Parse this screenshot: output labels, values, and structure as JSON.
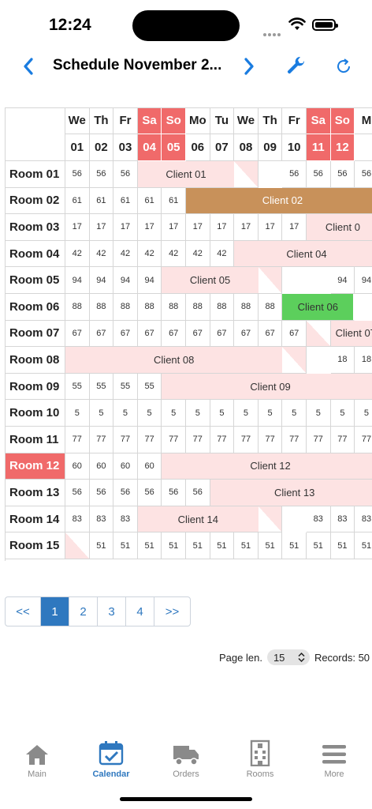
{
  "status": {
    "time": "12:24"
  },
  "nav": {
    "title": "Schedule November 2..."
  },
  "colors": {
    "accent": "#2f78bf",
    "weekend": "#f06a6a",
    "booking_pink": "#fde3e3",
    "booking_brown": "#c8915a",
    "booking_green": "#5ccf5c"
  },
  "days": [
    {
      "dow": "We",
      "date": "01",
      "we": false
    },
    {
      "dow": "Th",
      "date": "02",
      "we": false
    },
    {
      "dow": "Fr",
      "date": "03",
      "we": false
    },
    {
      "dow": "Sa",
      "date": "04",
      "we": true
    },
    {
      "dow": "So",
      "date": "05",
      "we": true
    },
    {
      "dow": "Mo",
      "date": "06",
      "we": false
    },
    {
      "dow": "Tu",
      "date": "07",
      "we": false
    },
    {
      "dow": "We",
      "date": "08",
      "we": false
    },
    {
      "dow": "Th",
      "date": "09",
      "we": false
    },
    {
      "dow": "Fr",
      "date": "10",
      "we": false
    },
    {
      "dow": "Sa",
      "date": "11",
      "we": true
    },
    {
      "dow": "So",
      "date": "12",
      "we": true
    },
    {
      "dow": "M",
      "date": "",
      "we": false
    }
  ],
  "rooms": [
    {
      "name": "Room 01",
      "price": "56",
      "selected": false,
      "free": [
        0,
        1,
        2,
        9,
        10,
        11,
        12
      ],
      "booking": {
        "label": "Client 01",
        "start": 3,
        "end": 7,
        "color": "pink",
        "tail": true,
        "head": false
      }
    },
    {
      "name": "Room 02",
      "price": "61",
      "selected": false,
      "free": [
        0,
        1,
        2,
        3,
        4
      ],
      "booking": {
        "label": "Client 02",
        "start": 5,
        "end": 12,
        "color": "brown",
        "tail": false,
        "head": false
      }
    },
    {
      "name": "Room 03",
      "price": "17",
      "selected": false,
      "free": [
        0,
        1,
        2,
        3,
        4,
        5,
        6,
        7,
        8,
        9
      ],
      "booking": {
        "label": "Client 0",
        "start": 10,
        "end": 12,
        "color": "pink",
        "tail": false,
        "head": false
      }
    },
    {
      "name": "Room 04",
      "price": "42",
      "selected": false,
      "free": [
        0,
        1,
        2,
        3,
        4,
        5,
        6
      ],
      "booking": {
        "label": "Client 04",
        "start": 7,
        "end": 12,
        "color": "pink",
        "tail": false,
        "head": false
      }
    },
    {
      "name": "Room 05",
      "price": "94",
      "selected": false,
      "free": [
        0,
        1,
        2,
        3,
        11,
        12
      ],
      "booking": {
        "label": "Client 05",
        "start": 4,
        "end": 8,
        "color": "pink",
        "tail": true,
        "head": false
      }
    },
    {
      "name": "Room 06",
      "price": "88",
      "selected": false,
      "free": [
        0,
        1,
        2,
        3,
        4,
        5,
        6,
        7,
        8
      ],
      "booking": {
        "label": "Client 06",
        "start": 9,
        "end": 11,
        "color": "green",
        "tail": false,
        "head": false
      }
    },
    {
      "name": "Room 07",
      "price": "67",
      "selected": false,
      "free": [
        0,
        1,
        2,
        3,
        4,
        5,
        6,
        7,
        8,
        9
      ],
      "booking": {
        "label": "Client 07",
        "start": 10,
        "end": 12,
        "color": "pink",
        "tail": false,
        "head": true
      }
    },
    {
      "name": "Room 08",
      "price": "18",
      "selected": false,
      "free": [
        11,
        12
      ],
      "booking": {
        "label": "Client 08",
        "start": 0,
        "end": 9,
        "color": "pink",
        "tail": true,
        "head": false
      }
    },
    {
      "name": "Room 09",
      "price": "55",
      "selected": false,
      "free": [
        0,
        1,
        2,
        3
      ],
      "booking": {
        "label": "Client 09",
        "start": 4,
        "end": 12,
        "color": "pink",
        "tail": false,
        "head": false
      }
    },
    {
      "name": "Room 10",
      "price": "5",
      "selected": false,
      "free": [
        0,
        1,
        2,
        3,
        4,
        5,
        6,
        7,
        8,
        9,
        10,
        11,
        12
      ],
      "booking": null
    },
    {
      "name": "Room 11",
      "price": "77",
      "selected": false,
      "free": [
        0,
        1,
        2,
        3,
        4,
        5,
        6,
        7,
        8,
        9,
        10,
        11,
        12
      ],
      "booking": null
    },
    {
      "name": "Room 12",
      "price": "60",
      "selected": true,
      "free": [
        0,
        1,
        2,
        3
      ],
      "booking": {
        "label": "Client 12",
        "start": 4,
        "end": 12,
        "color": "pink",
        "tail": false,
        "head": false
      }
    },
    {
      "name": "Room 13",
      "price": "56",
      "selected": false,
      "free": [
        0,
        1,
        2,
        3,
        4,
        5
      ],
      "booking": {
        "label": "Client 13",
        "start": 6,
        "end": 12,
        "color": "pink",
        "tail": false,
        "head": false
      }
    },
    {
      "name": "Room 14",
      "price": "83",
      "selected": false,
      "free": [
        0,
        1,
        2,
        10,
        11,
        12
      ],
      "booking": {
        "label": "Client 14",
        "start": 3,
        "end": 8,
        "color": "pink",
        "tail": true,
        "head": false
      }
    },
    {
      "name": "Room 15",
      "price": "51",
      "selected": false,
      "free": [
        1,
        2,
        3,
        4,
        5,
        6,
        7,
        8,
        9,
        10,
        11,
        12
      ],
      "booking": {
        "label": "",
        "start": 0,
        "end": 0,
        "color": "pink",
        "tail": false,
        "head": true
      }
    }
  ],
  "pager": {
    "prev": "<<",
    "pages": [
      "1",
      "2",
      "3",
      "4"
    ],
    "next": ">>",
    "active": "1"
  },
  "footer": {
    "page_len_label": "Page len.",
    "page_len_value": "15",
    "records_label": "Records: 50"
  },
  "tabs": [
    {
      "label": "Main",
      "icon": "home-icon",
      "active": false
    },
    {
      "label": "Calendar",
      "icon": "calendar-icon",
      "active": true
    },
    {
      "label": "Orders",
      "icon": "truck-icon",
      "active": false
    },
    {
      "label": "Rooms",
      "icon": "building-icon",
      "active": false
    },
    {
      "label": "More",
      "icon": "menu-icon",
      "active": false
    }
  ]
}
